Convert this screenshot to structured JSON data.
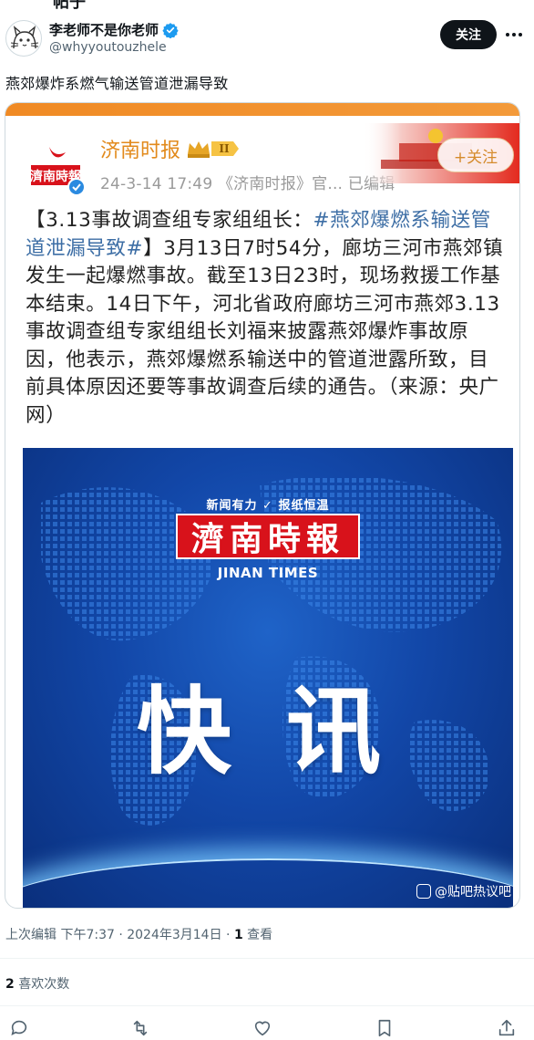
{
  "top_cut_text": "帖子",
  "author": {
    "display_name": "李老师不是你老师",
    "handle": "@whyyoutouzhele",
    "follow_label": "关注",
    "verified_color": "#1d9bf0"
  },
  "tweet_text": "燕郊爆炸系燃气输送管道泄漏导致",
  "embedded_post": {
    "account_name": "济南时报",
    "meta": "24-3-14 17:49 《济南时报》官... 已编辑",
    "follow_label": "+关注",
    "body_prefix": "【3.13事故调查组专家组组长：",
    "body_tag": "#燕郊爆燃系输送管道泄漏导致#",
    "body_rest": "】3月13日7时54分，廊坊三河市燕郊镇发生一起爆燃事故。截至13日23时，现场救援工作基本结束。14日下午，河北省政府廊坊三河市燕郊3.13事故调查组专家组组长刘福来披露燕郊爆炸事故原因，他表示，燕郊爆燃系输送中的管道泄露所致，目前具体原因还要等事故调查后续的通告。（来源：央广网）",
    "accent_color": "#e28a1c",
    "tag_color": "#3d6ea5"
  },
  "news_image": {
    "slogan": "新闻有力 ✓ 报纸恒温",
    "logo_cn": "濟南時報",
    "logo_en": "JINAN TIMES",
    "headline": "快讯",
    "watermark": "@贴吧热议吧"
  },
  "meta_line": {
    "edited": "上次编辑",
    "time": "下午7:37 · 2024年3月14日",
    "views_count": "1",
    "views_label": "查看"
  },
  "likes": {
    "count": "2",
    "label": "喜欢次数"
  },
  "actions": [
    "reply-icon",
    "retweet-icon",
    "like-icon",
    "bookmark-icon",
    "share-icon"
  ]
}
